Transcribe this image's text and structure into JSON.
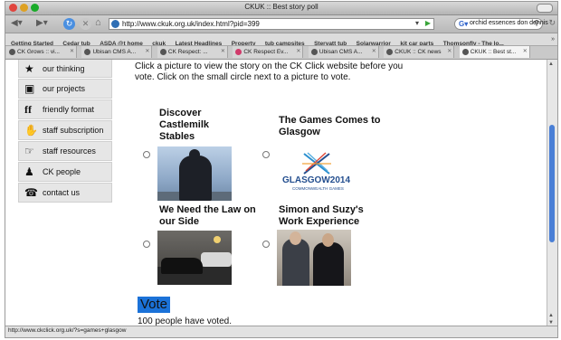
{
  "window": {
    "title": "CKUK :: Best story poll"
  },
  "toolbar": {
    "url": "http://www.ckuk.org.uk/index.html?pid=399",
    "search_text": "orchid essences don dennis"
  },
  "bookmarks": [
    "Getting Started",
    "Cedar tub",
    "ASDA @t home",
    "ckuk",
    "Latest Headlines",
    "Property",
    "tub campsites",
    "Stervatt tub",
    "Solarwarrior",
    "kit car parts",
    "Thomsonfly - The lo..."
  ],
  "tabs": [
    {
      "label": "CK Grows :: vi...",
      "active": false
    },
    {
      "label": "Ubisan CMS A...",
      "active": false
    },
    {
      "label": "CK Respect: ...",
      "active": false
    },
    {
      "label": "CK Respect Ev...",
      "active": false
    },
    {
      "label": "Ubisan CMS A...",
      "active": false
    },
    {
      "label": "CKUK :: CK news",
      "active": false
    },
    {
      "label": "CKUK :: Best st...",
      "active": true
    }
  ],
  "sidebar": {
    "items": [
      {
        "label": "our thinking",
        "icon": "speaker-person-icon"
      },
      {
        "label": "our projects",
        "icon": "projector-icon"
      },
      {
        "label": "friendly format",
        "icon": "ff-letters-icon"
      },
      {
        "label": "staff subscription",
        "icon": "subscription-hand-icon"
      },
      {
        "label": "staff resources",
        "icon": "pointing-hand-icon"
      },
      {
        "label": "CK people",
        "icon": "people-icon"
      },
      {
        "label": "contact us",
        "icon": "telephone-icon"
      }
    ]
  },
  "main": {
    "intro": "Click a picture to view the story on the CK Click website before you vote. Click on the small circle next to a picture to vote.",
    "stories": [
      {
        "title": "Discover Castlemilk Stables"
      },
      {
        "title": "The Games Comes to Glasgow",
        "logo_text": "GLASGOW2014",
        "logo_subtext": "COMMONWEALTH GAMES"
      },
      {
        "title": "We Need the Law on our Side"
      },
      {
        "title": "Simon and Suzy's Work Experience"
      }
    ],
    "vote_button": "Vote",
    "vote_count_text": "100 people have voted."
  },
  "status": {
    "text": "http://www.ckclick.org.uk/?s=games+glasgow"
  },
  "colors": {
    "vote_bg": "#1b72d8",
    "logo_blue": "#244f8f",
    "scroll_thumb": "#4a7fd6"
  }
}
